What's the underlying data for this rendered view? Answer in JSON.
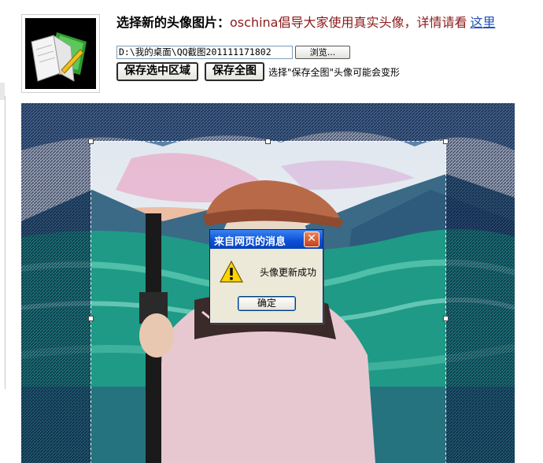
{
  "header": {
    "label": "选择新的头像图片：",
    "message": "oschina倡导大家使用真实头像，详情请看",
    "link_text": "这里"
  },
  "upload": {
    "file_path": "D:\\我的桌面\\QQ截图201111171802",
    "browse_label": "浏览..."
  },
  "actions": {
    "save_selection_label": "保存选中区域",
    "save_all_label": "保存全图",
    "note": "选择\"保存全图\"头像可能会变形"
  },
  "dialog": {
    "title": "来自网页的消息",
    "message": "头像更新成功",
    "ok_label": "确定",
    "icon": "warning-icon",
    "close_icon": "close-icon"
  },
  "colors": {
    "message_text": "#8b1a1a",
    "link": "#1f4fb8",
    "dialog_title_bar": "#0a4fd6"
  }
}
